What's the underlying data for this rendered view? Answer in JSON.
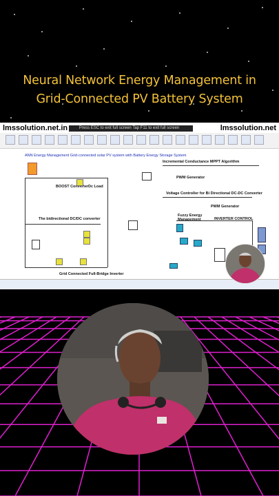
{
  "title": {
    "line1": "Neural Network Energy Management in",
    "line2": "Grid-Connected PV Battery System"
  },
  "watermark": {
    "left": "lmssolution.net.in",
    "right": "lmssolution.net"
  },
  "popup_text": "Press ESC to exit full screen   Tap F11 to exit full screen",
  "diagram": {
    "main_title": "ANN Energy Management Grid-connected solar PV system with Battery Energy Storage System",
    "mppt": "Incremental Conductance MPPT Algorithm",
    "pwm1": "PWM Generator",
    "boost": "BOOST Converter",
    "dc_load": "Dc Load",
    "bidir": "The bidirectional DC/DC converter",
    "voltage_ctrl": "Voltage Controller for Bi Directional DC-DC Converter",
    "pwm2": "PWM Generator",
    "fuzzy": "Fuzzy Energy Management",
    "inverter_ctrl": "INVERTER CONTROL",
    "inverter": "Grid Connected Full-Bridge Inverter"
  },
  "colors": {
    "title_gold": "#f3c23a",
    "grid_pink": "#e020d0",
    "diagram_blue": "#1b2fb5",
    "shirt": "#c0306a"
  },
  "icons": [
    "maximize-icon",
    "headphones-icon"
  ]
}
